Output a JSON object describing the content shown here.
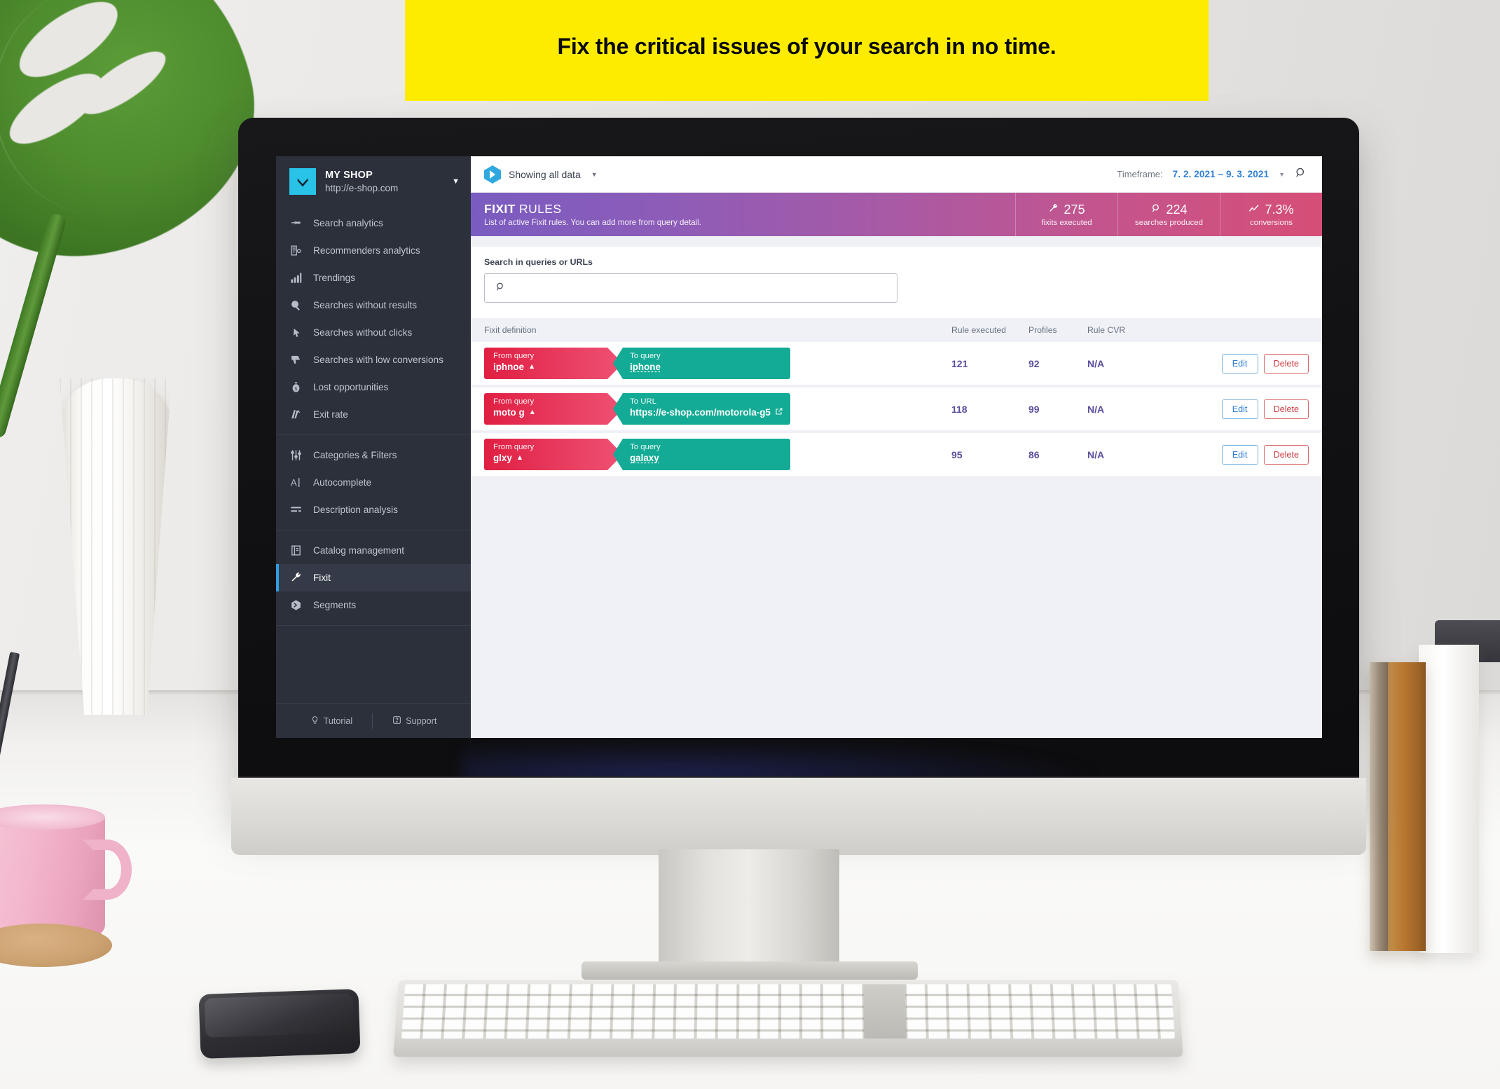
{
  "callout": {
    "text": "Fix the critical issues of your search in no time."
  },
  "sidebar": {
    "shop": {
      "name": "MY SHOP",
      "url": "http://e-shop.com",
      "logo_icon": "chevron-down-logo-icon",
      "dropdown_icon": "caret-down-icon"
    },
    "groups": [
      {
        "items": [
          {
            "label": "Search analytics",
            "icon": "pointing-hand-icon"
          },
          {
            "label": "Recommenders analytics",
            "icon": "document-bulb-icon"
          },
          {
            "label": "Trendings",
            "icon": "bar-chart-icon"
          },
          {
            "label": "Searches without results",
            "icon": "magnifier-slash-icon"
          },
          {
            "label": "Searches without clicks",
            "icon": "click-slash-icon"
          },
          {
            "label": "Searches with low conversions",
            "icon": "thumbs-down-icon"
          },
          {
            "label": "Lost opportunities",
            "icon": "money-bag-icon"
          },
          {
            "label": "Exit rate",
            "icon": "exit-arrow-icon"
          }
        ]
      },
      {
        "items": [
          {
            "label": "Categories & Filters",
            "icon": "sliders-icon"
          },
          {
            "label": "Autocomplete",
            "icon": "text-cursor-icon"
          },
          {
            "label": "Description analysis",
            "icon": "text-lines-icon"
          }
        ]
      },
      {
        "items": [
          {
            "label": "Catalog management",
            "icon": "book-icon"
          },
          {
            "label": "Fixit",
            "icon": "wrench-icon",
            "active": true
          },
          {
            "label": "Segments",
            "icon": "segments-icon"
          }
        ]
      }
    ],
    "footer": {
      "tutorial": "Tutorial",
      "tutorial_icon": "lightbulb-icon",
      "support": "Support",
      "support_icon": "question-circle-icon"
    }
  },
  "topbar": {
    "brand_icon": "luigis-box-logo-icon",
    "showing_label": "Showing all data",
    "showing_caret_icon": "caret-down-icon",
    "timeframe_label": "Timeframe:",
    "timeframe_value": "7. 2. 2021 – 9. 3. 2021",
    "timeframe_caret_icon": "caret-down-icon",
    "search_icon": "magnifier-icon"
  },
  "header": {
    "title_bold": "FIXIT",
    "title_light": "RULES",
    "subtitle": "List of active Fixit rules. You can add more from query detail.",
    "stats": [
      {
        "icon": "wrench-icon",
        "value": "275",
        "label": "fixits executed"
      },
      {
        "icon": "magnifier-icon",
        "value": "224",
        "label": "searches produced"
      },
      {
        "icon": "trend-up-icon",
        "value": "7.3%",
        "label": "conversions"
      }
    ]
  },
  "search": {
    "label": "Search in queries or URLs",
    "icon": "magnifier-icon",
    "value": "",
    "placeholder": ""
  },
  "table": {
    "columns": {
      "definition": "Fixit definition",
      "executed": "Rule executed",
      "profiles": "Profiles",
      "cvr": "Rule CVR"
    },
    "rows": [
      {
        "from_label": "From query",
        "from_value": "iphnoe",
        "from_warning_icon": "warning-triangle-icon",
        "to_label": "To query",
        "to_value": "iphone",
        "to_is_url": false,
        "executed": "121",
        "profiles": "92",
        "cvr": "N/A",
        "edit": "Edit",
        "delete": "Delete"
      },
      {
        "from_label": "From query",
        "from_value": "moto g",
        "from_warning_icon": "warning-triangle-icon",
        "to_label": "To URL",
        "to_value": "https://e-shop.com/motorola-g5",
        "to_is_url": true,
        "to_external_icon": "external-link-icon",
        "executed": "118",
        "profiles": "99",
        "cvr": "N/A",
        "edit": "Edit",
        "delete": "Delete"
      },
      {
        "from_label": "From query",
        "from_value": "glxy",
        "from_warning_icon": "warning-triangle-icon",
        "to_label": "To query",
        "to_value": "galaxy",
        "to_is_url": false,
        "executed": "95",
        "profiles": "86",
        "cvr": "N/A",
        "edit": "Edit",
        "delete": "Delete"
      }
    ]
  },
  "colors": {
    "callout_yellow": "#fdec00",
    "sidebar_bg": "#2b303b",
    "active_accent": "#2e9fe0",
    "shop_logo": "#29c3e8",
    "gradient_start": "#7a5cc0",
    "gradient_end": "#d64e77",
    "chip_from": "#e01f42",
    "chip_to": "#13ab95",
    "number_purple": "#5c4e9e",
    "link_blue": "#2e7fd6",
    "delete_red": "#cf3b40"
  }
}
